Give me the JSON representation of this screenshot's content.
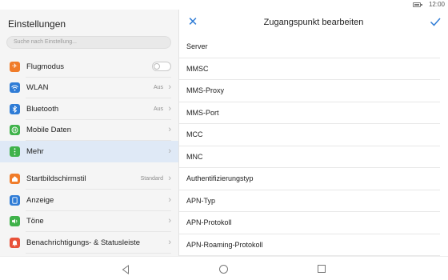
{
  "status_bar": {
    "time": "12:00",
    "battery_level": 0.8
  },
  "settings": {
    "title": "Einstellungen",
    "search_placeholder": "Suche nach Einstellung...",
    "items": [
      {
        "label": "Flugmodus",
        "icon": "airplane-icon",
        "color": "#f07c2a",
        "toggle": "off"
      },
      {
        "label": "WLAN",
        "value": "Aus",
        "icon": "wifi-icon",
        "color": "#2f7cd6"
      },
      {
        "label": "Bluetooth",
        "value": "Aus",
        "icon": "bluetooth-icon",
        "color": "#2f7cd6"
      },
      {
        "label": "Mobile Daten",
        "icon": "mobile-data-icon",
        "color": "#3fb24a"
      },
      {
        "label": "Mehr",
        "icon": "more-icon",
        "color": "#3fb24a",
        "selected": true
      },
      {
        "label": "Startbildschirmstil",
        "value": "Standard",
        "icon": "home-style-icon",
        "color": "#f07c2a"
      },
      {
        "label": "Anzeige",
        "icon": "display-icon",
        "color": "#2f7cd6"
      },
      {
        "label": "Töne",
        "icon": "sound-icon",
        "color": "#3fb24a"
      },
      {
        "label": "Benachrichtigungs- & Statusleiste",
        "icon": "notification-icon",
        "color": "#e8523a"
      }
    ]
  },
  "apn_editor": {
    "title": "Zugangspunkt bearbeiten",
    "accent_color": "#2f7cd6",
    "fields": [
      "Server",
      "MMSC",
      "MMS-Proxy",
      "MMS-Port",
      "MCC",
      "MNC",
      "Authentifizierungstyp",
      "APN-Typ",
      "APN-Protokoll",
      "APN-Roaming-Protokoll"
    ]
  },
  "nav_bar": {
    "back": "back-icon",
    "home": "home-icon",
    "recents": "recents-icon"
  }
}
